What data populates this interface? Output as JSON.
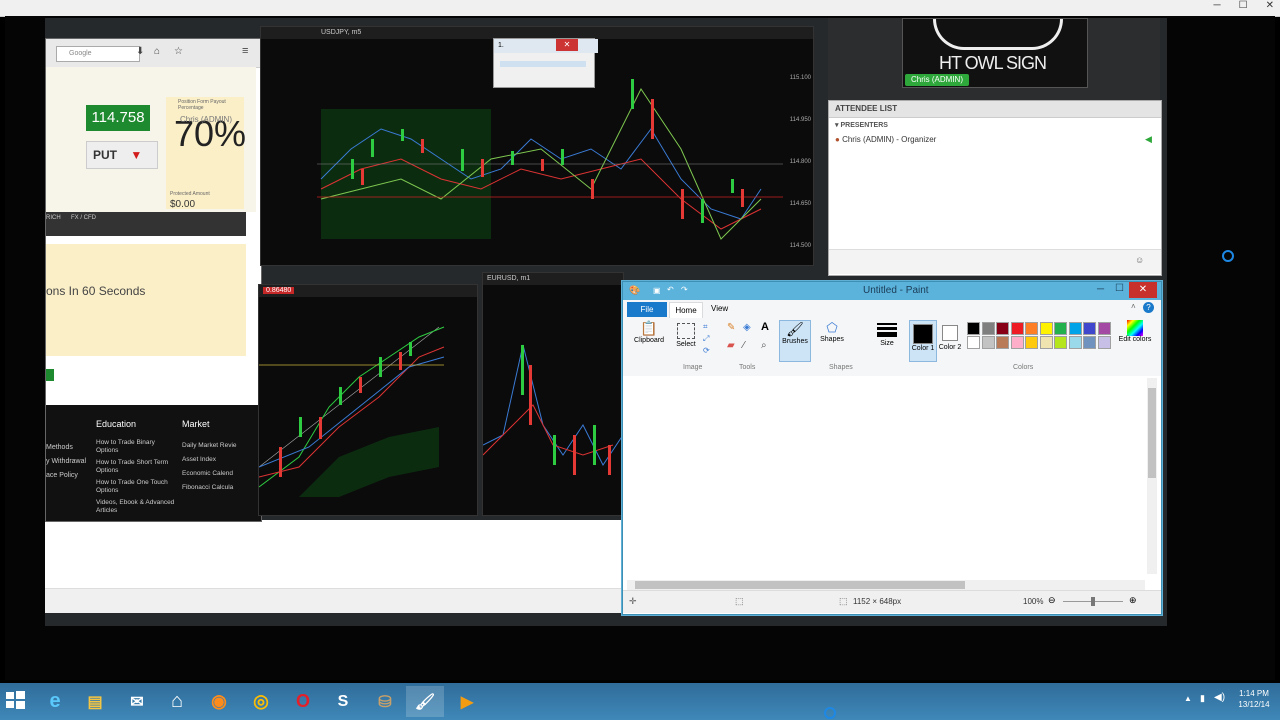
{
  "outer_window": {
    "minimize": "─",
    "maximize": "☐",
    "close": "✕"
  },
  "browser": {
    "search_placeholder": "Google",
    "price": "114.758",
    "put_label": "PUT",
    "payout_label": "Position Form Payout Percentage",
    "presenter_overlay": "Chris (ADMIN)",
    "payout_value": "70%",
    "protected_label": "Protected Amount",
    "protected_value": "$0.00",
    "tabs": [
      "RICH",
      "FX / CFD"
    ],
    "headline": "ons In 60 Seconds",
    "footer": {
      "col1_items": [
        "Methods",
        "y Withdrawal",
        "ace Policy"
      ],
      "education_title": "Education",
      "education_items": [
        "How to Trade Binary Options",
        "How to Trade Short Term Options",
        "How to Trade One Touch Options",
        "Videos, Ebook & Advanced Articles"
      ],
      "market_title": "Market",
      "market_items": [
        "Daily Market Revie",
        "Asset Index",
        "Economic Calend",
        "Fibonacci Calcula"
      ]
    }
  },
  "charts": {
    "top_title": "USDJPY, m5",
    "top_axis": [
      "115.100",
      "114.950",
      "114.800",
      "114.650",
      "114.500"
    ],
    "bottom_left_title": "0.86480",
    "bottom_right_title": "EURUSD, m1",
    "mini_window_title": "1."
  },
  "gtw": {
    "logo_text": "HT OWL SIGN",
    "presenter_tag": "Chris (ADMIN)",
    "attendee_header": "ATTENDEE LIST",
    "presenters_label": "PRESENTERS",
    "presenter_entry": "Chris (ADMIN) - Organizer"
  },
  "paint": {
    "title": "Untitled - Paint",
    "tabs": {
      "file": "File",
      "home": "Home",
      "view": "View"
    },
    "groups": {
      "clipboard": "Clipboard",
      "select": "Select",
      "image": "Image",
      "tools": "Tools",
      "brushes": "Brushes",
      "shapes": "Shapes",
      "size": "Size",
      "color1": "Color 1",
      "color2": "Color 2",
      "colors": "Colors",
      "edit_colors": "Edit colors"
    },
    "palette_row1": [
      "#000000",
      "#7f7f7f",
      "#880015",
      "#ed1c24",
      "#ff7f27",
      "#fff200",
      "#22b14c",
      "#00a2e8",
      "#3f48cc",
      "#a349a4"
    ],
    "palette_row2": [
      "#ffffff",
      "#c3c3c3",
      "#b97a57",
      "#ffaec9",
      "#ffc90e",
      "#efe4b0",
      "#b5e61d",
      "#99d9ea",
      "#7092be",
      "#c8bfe7"
    ],
    "color1": "#000000",
    "color2": "#ffffff",
    "status": {
      "dimensions": "1152 × 648px",
      "zoom": "100%"
    }
  },
  "taskbar": {
    "icons": [
      "ie-icon",
      "explorer-icon",
      "outlook-icon",
      "home-icon",
      "firefox-icon",
      "chrome-icon",
      "opera-icon",
      "skype-icon",
      "archive-icon",
      "paint-icon",
      "media-icon"
    ],
    "time": "1:14 PM",
    "date": "13/12/14"
  }
}
